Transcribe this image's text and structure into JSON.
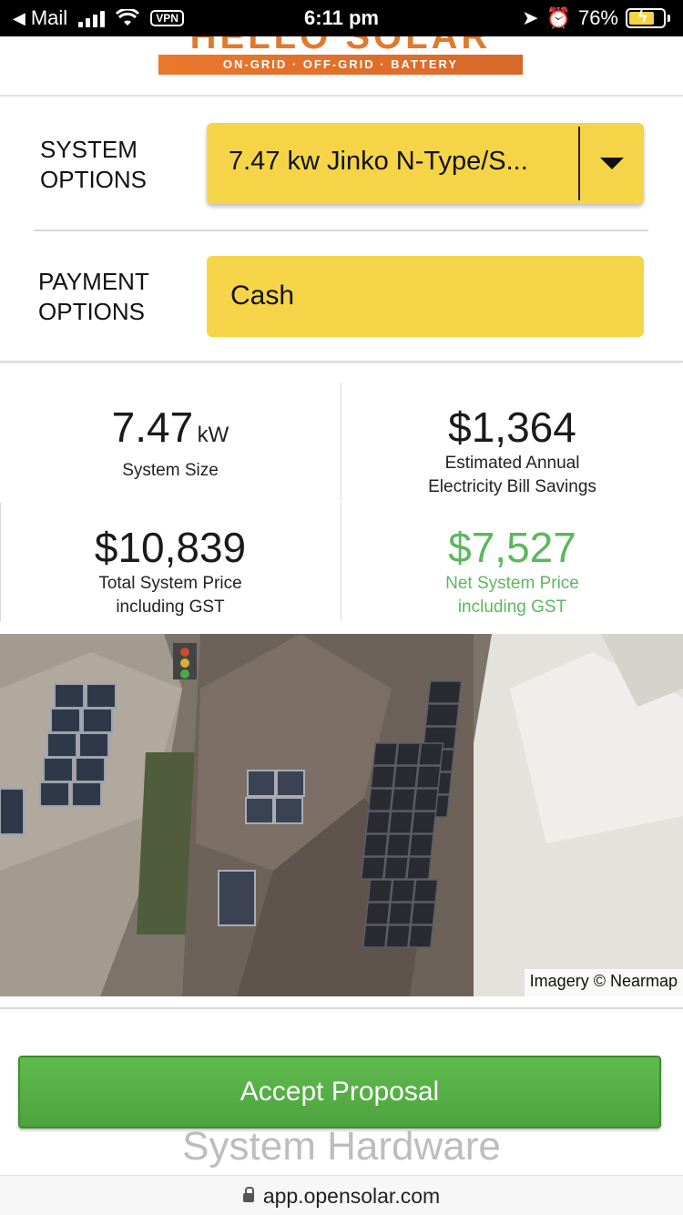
{
  "status_bar": {
    "back_app": "Mail",
    "vpn": "VPN",
    "time": "6:11 pm",
    "battery": "76%"
  },
  "header": {
    "logo_wordmark": "HELLO SOLAR",
    "logo_tagline": "ON-GRID · OFF-GRID · BATTERY"
  },
  "options": {
    "system_label": "SYSTEM OPTIONS",
    "system_value": "7.47 kw Jinko N-Type/S...",
    "payment_label": "PAYMENT OPTIONS",
    "payment_value": "Cash"
  },
  "stats": {
    "system_size_value": "7.47",
    "system_size_unit": "kW",
    "system_size_label": "System Size",
    "savings_value": "$1,364",
    "savings_label_1": "Estimated Annual",
    "savings_label_2": "Electricity Bill Savings",
    "total_price_value": "$10,839",
    "total_price_label_1": "Total System Price",
    "total_price_label_2": "including GST",
    "net_price_value": "$7,527",
    "net_price_label_1": "Net System Price",
    "net_price_label_2": "including GST"
  },
  "imagery": {
    "attribution": "Imagery © Nearmap"
  },
  "actions": {
    "accept_label": "Accept Proposal"
  },
  "section": {
    "hardware_title": "System Hardware"
  },
  "browser": {
    "url": "app.opensolar.com"
  },
  "colors": {
    "accent_yellow": "#f5d547",
    "green": "#5cb85c",
    "logo_orange": "#e07a2e"
  }
}
